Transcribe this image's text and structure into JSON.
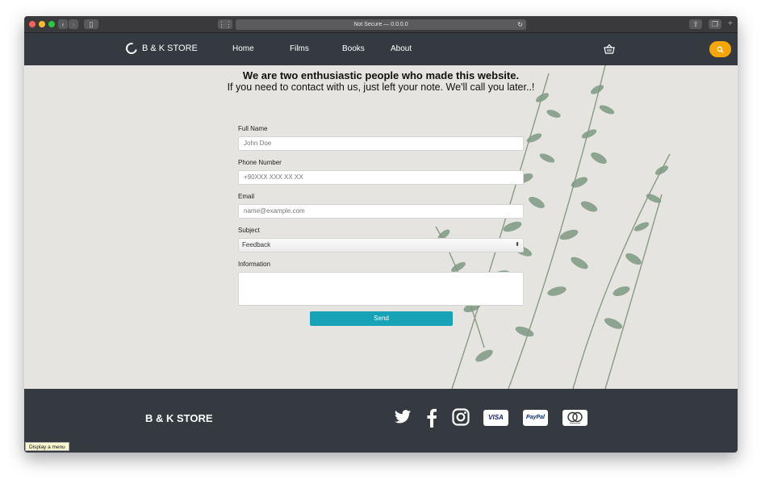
{
  "browser": {
    "address": "Not Secure — 0.0.0.0",
    "tooltip": "Display a menu"
  },
  "navbar": {
    "brand": "B & K STORE",
    "links": [
      "Home",
      "Films",
      "Books",
      "About"
    ]
  },
  "hero": {
    "title": "We are two enthusiastic people who made this website.",
    "subtitle": "If you need to contact with us, just left your note. We'll call you later..!"
  },
  "form": {
    "full_name": {
      "label": "Full Name",
      "placeholder": "John Doe"
    },
    "phone": {
      "label": "Phone Number",
      "placeholder": "+90XXX XXX XX XX"
    },
    "email": {
      "label": "Email",
      "placeholder": "name@example.com"
    },
    "subject": {
      "label": "Subject",
      "selected": "Feedback"
    },
    "information": {
      "label": "Information",
      "value": ""
    },
    "send_label": "Send"
  },
  "footer": {
    "brand": "B & K STORE",
    "cards": {
      "visa": "VISA",
      "paypal": "PayPal"
    }
  },
  "colors": {
    "navbar": "#343a40",
    "accent_search": "#f6a600",
    "send_button": "#17a2b8"
  },
  "icons": [
    "back-icon",
    "forward-icon",
    "sidebar-icon",
    "grid-icon",
    "reload-icon",
    "share-icon",
    "tabs-icon",
    "cart-icon",
    "search-icon",
    "twitter-icon",
    "facebook-icon",
    "instagram-icon",
    "visa-icon",
    "paypal-icon",
    "mastercard-icon"
  ]
}
